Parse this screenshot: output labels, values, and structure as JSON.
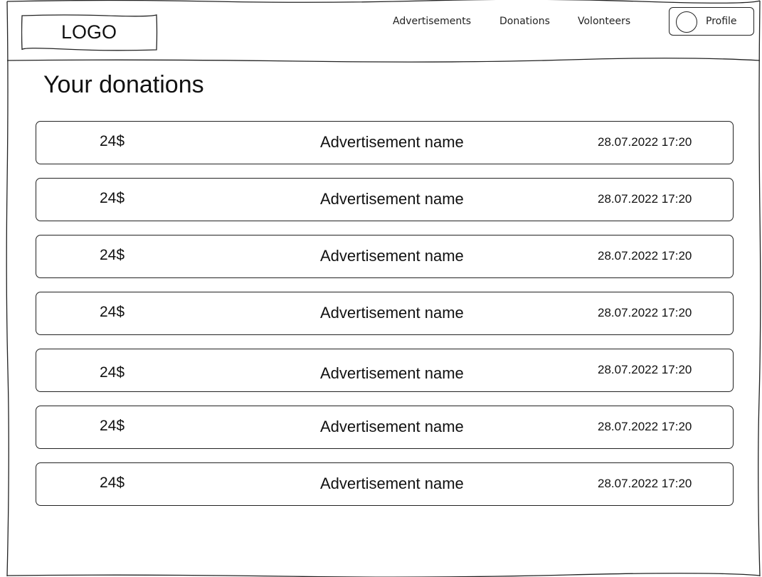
{
  "header": {
    "logo": "LOGO",
    "nav": [
      {
        "label": "Advertisements"
      },
      {
        "label": "Donations"
      },
      {
        "label": "Volonteers"
      }
    ],
    "profile_label": "Profile"
  },
  "main": {
    "title": "Your donations",
    "donations": [
      {
        "amount": "24$",
        "advertisement": "Advertisement name",
        "date": "28.07.2022 17:20"
      },
      {
        "amount": "24$",
        "advertisement": "Advertisement name",
        "date": "28.07.2022 17:20"
      },
      {
        "amount": "24$",
        "advertisement": "Advertisement name",
        "date": "28.07.2022 17:20"
      },
      {
        "amount": "24$",
        "advertisement": "Advertisement name",
        "date": "28.07.2022 17:20"
      },
      {
        "amount": "24$",
        "advertisement": "Advertisement name",
        "date": "28.07.2022 17:20"
      },
      {
        "amount": "24$",
        "advertisement": "Advertisement name",
        "date": "28.07.2022 17:20"
      },
      {
        "amount": "24$",
        "advertisement": "Advertisement name",
        "date": "28.07.2022 17:20"
      }
    ]
  }
}
